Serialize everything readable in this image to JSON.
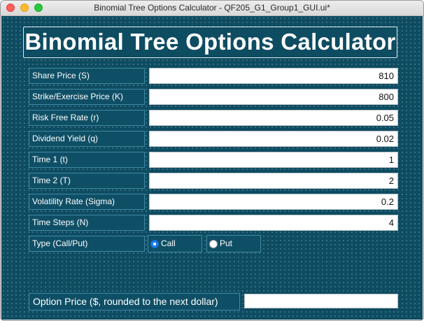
{
  "window": {
    "title": "Binomial Tree Options Calculator - QF205_G1_Group1_GUI.ui*"
  },
  "heading": "Binomial Tree Options Calculator",
  "fields": {
    "share_price": {
      "label": "Share Price (S)",
      "value": "810"
    },
    "strike_price": {
      "label": "Strike/Exercise Price (K)",
      "value": "800"
    },
    "risk_free_rate": {
      "label": "Risk Free Rate (r)",
      "value": "0.05"
    },
    "dividend_yield": {
      "label": "Dividend Yield (q)",
      "value": "0.02"
    },
    "time_1": {
      "label": "Time 1 (t)",
      "value": "1"
    },
    "time_2": {
      "label": "Time 2 (T)",
      "value": "2"
    },
    "volatility": {
      "label": "Volatility Rate (Sigma)",
      "value": "0.2"
    },
    "time_steps": {
      "label": "Time Steps (N)",
      "value": "4"
    }
  },
  "option_type": {
    "label": "Type (Call/Put)",
    "call_label": "Call",
    "put_label": "Put",
    "selected": "Call"
  },
  "result": {
    "label": "Option Price ($, rounded to the next dollar)",
    "value": ""
  },
  "colors": {
    "background": "#0e4c62",
    "label_border": "#3f8aa3",
    "radio_selected": "#1e7ef0"
  }
}
